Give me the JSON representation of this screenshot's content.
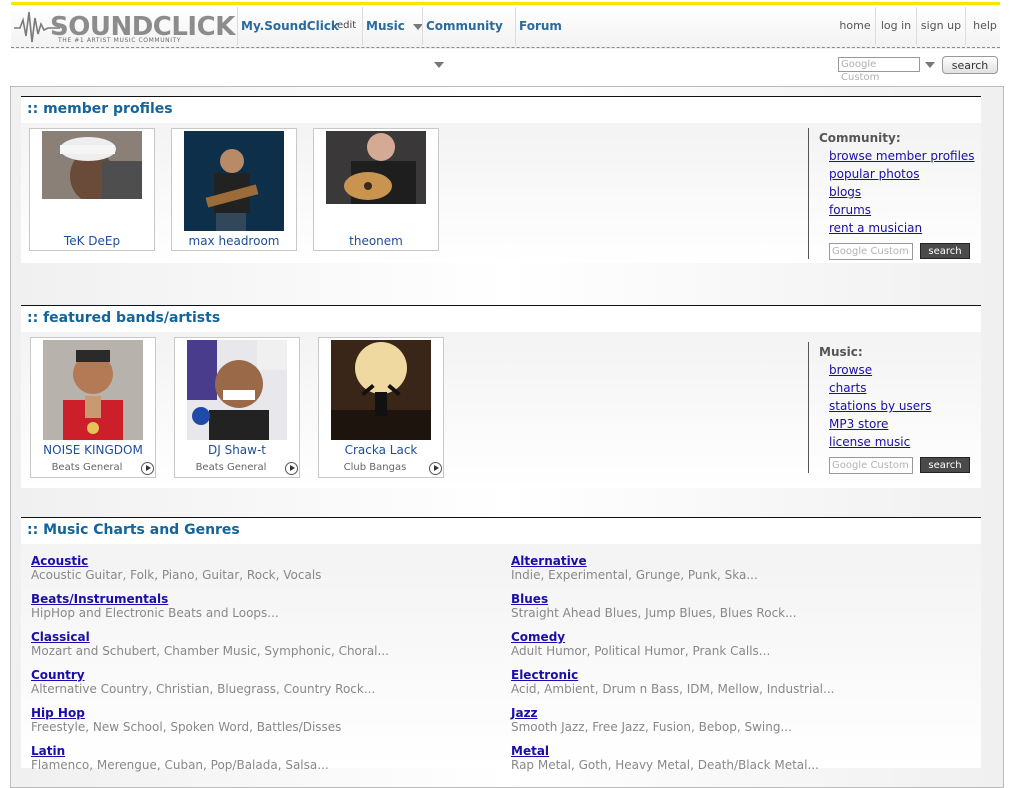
{
  "logo": {
    "brand": "SOUNDCLICK",
    "tagline": "THE #1 ARTIST MUSIC COMMUNITY"
  },
  "nav": {
    "mysoundclick": "My.SoundClick",
    "edit": "edit",
    "music": "Music",
    "community": "Community",
    "forum": "Forum"
  },
  "right_nav": {
    "home": "home",
    "login": "log in",
    "signup": "sign up",
    "help": "help"
  },
  "header_search": {
    "placeholder": "Google Custom",
    "button": "search"
  },
  "member_profiles": {
    "title": ":: member profiles",
    "members": [
      {
        "name": "TeK DeEp"
      },
      {
        "name": "max headroom"
      },
      {
        "name": "theonem"
      }
    ],
    "sidebar": {
      "title": "Community:",
      "links": [
        "browse member profiles",
        "popular photos",
        "blogs",
        "forums",
        "rent a musician"
      ],
      "search_placeholder": "Google Custom",
      "search_button": "search"
    }
  },
  "featured": {
    "title": ":: featured bands/artists",
    "artists": [
      {
        "name": "NOISE KINGDOM",
        "genre": "Beats General"
      },
      {
        "name": "DJ Shaw-t",
        "genre": "Beats General"
      },
      {
        "name": "Cracka Lack",
        "genre": "Club Bangas"
      }
    ],
    "sidebar": {
      "title": "Music:",
      "links": [
        "browse",
        "charts",
        "stations by users",
        "MP3 store",
        "license music"
      ],
      "search_placeholder": "Google Custom",
      "search_button": "search"
    }
  },
  "charts": {
    "title": ":: Music Charts and Genres",
    "left": [
      {
        "name": "Acoustic",
        "sub": "Acoustic Guitar, Folk, Piano, Guitar, Rock, Vocals"
      },
      {
        "name": "Beats/Instrumentals",
        "sub": "HipHop and Electronic Beats and Loops..."
      },
      {
        "name": "Classical",
        "sub": "Mozart and Schubert, Chamber Music, Symphonic, Choral..."
      },
      {
        "name": "Country",
        "sub": "Alternative Country, Christian, Bluegrass, Country Rock..."
      },
      {
        "name": "Hip Hop",
        "sub": "Freestyle, New School, Spoken Word, Battles/Disses"
      },
      {
        "name": "Latin",
        "sub": "Flamenco, Merengue, Cuban, Pop/Balada, Salsa..."
      }
    ],
    "right": [
      {
        "name": "Alternative",
        "sub": "Indie, Experimental, Grunge, Punk, Ska..."
      },
      {
        "name": "Blues",
        "sub": "Straight Ahead Blues, Jump Blues, Blues Rock..."
      },
      {
        "name": "Comedy",
        "sub": "Adult Humor, Political Humor, Prank Calls..."
      },
      {
        "name": "Electronic",
        "sub": "Acid, Ambient, Drum n Bass, IDM, Mellow, Industrial..."
      },
      {
        "name": "Jazz",
        "sub": "Smooth Jazz, Free Jazz, Fusion, Bebop, Swing..."
      },
      {
        "name": "Metal",
        "sub": "Rap Metal, Goth, Heavy Metal, Death/Black Metal..."
      }
    ]
  }
}
